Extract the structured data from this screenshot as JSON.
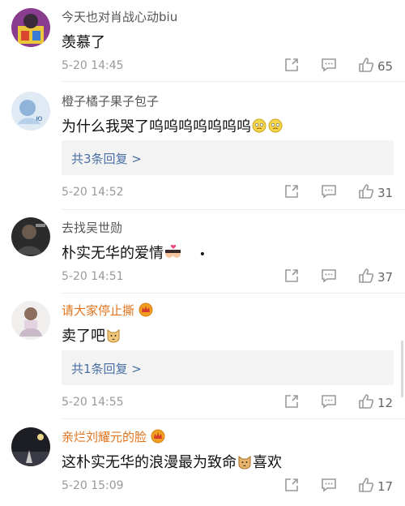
{
  "comments": [
    {
      "username": "今天也对肖战心动biu",
      "text": "羡慕了",
      "time": "5-20 14:45",
      "likes": "65",
      "avatar_icon": "avatar-book-girl",
      "vip": false
    },
    {
      "username": "橙子橘子果子包子",
      "text": "为什么我哭了呜呜呜呜呜呜呜",
      "time": "5-20 14:52",
      "likes": "31",
      "replies": "共3条回复 >",
      "avatar_icon": "avatar-anime",
      "vip": false
    },
    {
      "username": "去找吴世勋",
      "text": "朴实无华的爱情",
      "time": "5-20 14:51",
      "likes": "37",
      "avatar_icon": "avatar-dark-portrait",
      "vip": false
    },
    {
      "username": "请大家停止撕",
      "text": "卖了吧",
      "time": "5-20 14:55",
      "likes": "12",
      "replies": "共1条回复 >",
      "avatar_icon": "avatar-girl-seated",
      "vip": true
    },
    {
      "username": "亲烂刘耀元的脸",
      "text": "这朴实无华的浪漫最为致命",
      "text_suffix": "喜欢",
      "time": "5-20 15:09",
      "likes": "17",
      "avatar_icon": "avatar-night-scene",
      "vip": true
    }
  ],
  "colors": {
    "vip_name": "#e0741e",
    "link": "#4a6fa5",
    "icon": "#9a9a9a"
  },
  "icons": [
    "share-icon",
    "comment-icon",
    "like-icon",
    "crown-badge-icon",
    "emoji-icon"
  ]
}
